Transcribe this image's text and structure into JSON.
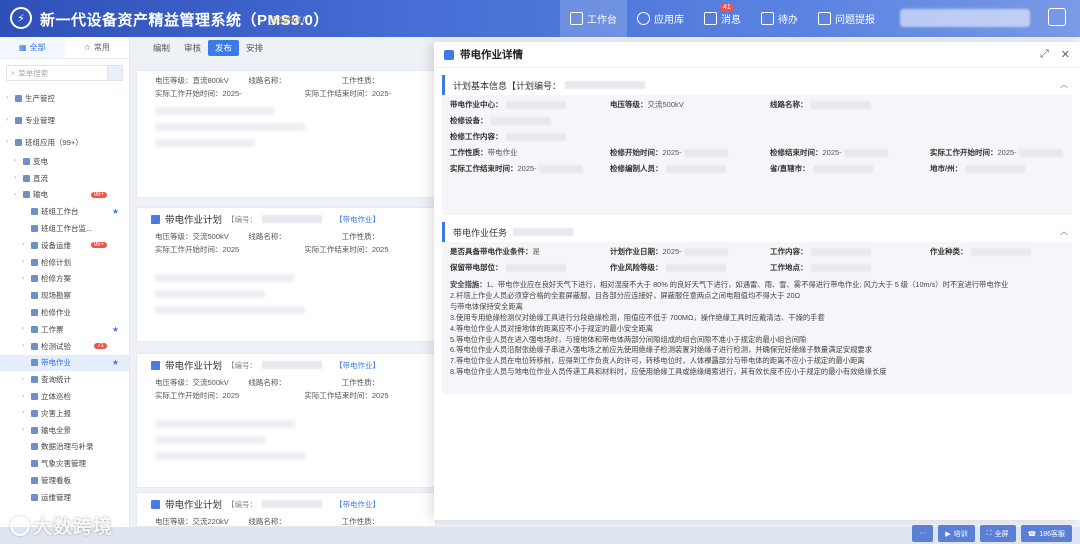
{
  "header": {
    "title": "新一代设备资产精益管理系统（PMS3.0）",
    "slogan": "我来修！",
    "nav": [
      {
        "label": "工作台",
        "icon": "monitor-icon"
      },
      {
        "label": "应用库",
        "icon": "apps-icon"
      },
      {
        "label": "消息",
        "icon": "message-icon",
        "badge": "41"
      },
      {
        "label": "待办",
        "icon": "todo-icon"
      },
      {
        "label": "问题提报",
        "icon": "report-icon"
      }
    ]
  },
  "sidebar": {
    "tabs": [
      "全部",
      "常用"
    ],
    "search_placeholder": "菜单搜索",
    "items": [
      {
        "label": "生产管控",
        "level": 1
      },
      {
        "label": "专业管理",
        "level": 1
      },
      {
        "label": "班组应用（99+）",
        "level": 1
      },
      {
        "label": "变电",
        "level": 2
      },
      {
        "label": "直流",
        "level": 2
      },
      {
        "label": "输电",
        "level": 2,
        "badge": "99+"
      },
      {
        "label": "班组工作台",
        "level": 3,
        "star": true
      },
      {
        "label": "班组工作台监...",
        "level": 3
      },
      {
        "label": "设备运维",
        "level": 3,
        "badge": "99+"
      },
      {
        "label": "检修计划",
        "level": 3
      },
      {
        "label": "检修方案",
        "level": 3
      },
      {
        "label": "现场勘察",
        "level": 3
      },
      {
        "label": "检修作业",
        "level": 3
      },
      {
        "label": "工作票",
        "level": 3,
        "star": true
      },
      {
        "label": "检测试验",
        "level": 3,
        "badge": "71"
      },
      {
        "label": "带电作业",
        "level": 3,
        "star": true,
        "active": true
      },
      {
        "label": "查询统计",
        "level": 3
      },
      {
        "label": "立体巡检",
        "level": 3
      },
      {
        "label": "灾害上报",
        "level": 3
      },
      {
        "label": "输电全景",
        "level": 3
      },
      {
        "label": "数据治理与补录",
        "level": 3
      },
      {
        "label": "气象灾害管理",
        "level": 3
      },
      {
        "label": "管理看板",
        "level": 3
      },
      {
        "label": "运维管理",
        "level": 3
      }
    ]
  },
  "main": {
    "subtabs": [
      "编制",
      "审核",
      "发布",
      "安排"
    ],
    "active_subtab": "发布",
    "top_fields": {
      "voltage": "电压等级：直流800kV",
      "line": "线路名称：",
      "nature": "工作性质：",
      "start": "实际工作开始时间：2025-",
      "end": "实际工作结束时间：2025-"
    },
    "cards": [
      {
        "title": "带电作业计划",
        "code": "【编号：",
        "tag": "【带电作业】",
        "voltage": "电压等级：交流500kV",
        "line": "线路名称：",
        "nature": "工作性质：",
        "start": "实际工作开始时间：2025",
        "end": "实际工作结束时间：2025"
      },
      {
        "title": "带电作业计划",
        "code": "【编号：",
        "tag": "【带电作业】",
        "voltage": "电压等级：交流500kV",
        "line": "线路名称：",
        "nature": "工作性质：",
        "start": "实际工作开始时间：2025",
        "end": "实际工作结束时间：2025"
      },
      {
        "title": "带电作业计划",
        "code": "【编号：",
        "tag": "【带电作业】",
        "voltage": "电压等级：交流220kV",
        "line": "线路名称：",
        "nature": "工作性质：",
        "start": "实际工作开始时间：2025",
        "end": "实际工作结束时间：2025"
      }
    ]
  },
  "drawer": {
    "title": "带电作业详情",
    "basic_section": "计划基本信息【计划编号：",
    "basic_rows": [
      [
        {
          "k": "带电作业中心：",
          "v": ""
        },
        {
          "k": "电压等级：",
          "v": "交流500kV"
        },
        {
          "k": "线路名称：",
          "v": ""
        },
        {
          "k": "",
          "v": ""
        }
      ],
      [
        {
          "k": "检修设备：",
          "v": ""
        },
        {
          "k": "",
          "v": ""
        },
        {
          "k": "",
          "v": ""
        },
        {
          "k": "",
          "v": ""
        }
      ],
      [
        {
          "k": "检修工作内容：",
          "v": ""
        },
        {
          "k": "",
          "v": ""
        },
        {
          "k": "",
          "v": ""
        },
        {
          "k": "",
          "v": ""
        }
      ],
      [
        {
          "k": "工作性质：",
          "v": "带电作业"
        },
        {
          "k": "检修开始时间：",
          "v": "2025-"
        },
        {
          "k": "检修结束时间：",
          "v": "2025-"
        },
        {
          "k": "实际工作开始时间：",
          "v": "2025-"
        }
      ],
      [
        {
          "k": "实际工作结束时间：",
          "v": "2025-"
        },
        {
          "k": "检修编制人员：",
          "v": ""
        },
        {
          "k": "省/直辖市：",
          "v": ""
        },
        {
          "k": "地市/州：",
          "v": ""
        }
      ]
    ],
    "task_section": "带电作业任务",
    "task_rows": [
      [
        {
          "k": "是否具备带电作业条件：",
          "v": "是"
        },
        {
          "k": "计划作业日期：",
          "v": "2025-"
        },
        {
          "k": "工作内容：",
          "v": ""
        },
        {
          "k": "作业种类：",
          "v": ""
        }
      ],
      [
        {
          "k": "保留带电部位：",
          "v": ""
        },
        {
          "k": "作业风险等级：",
          "v": ""
        },
        {
          "k": "工作地点：",
          "v": ""
        },
        {
          "k": "",
          "v": ""
        }
      ]
    ],
    "measures_label": "安全措施：",
    "measures": [
      "1、带电作业应在良好天气下进行，相对湿度不大于 80% 的良好天气下进行，如遇雷、雨、雪、雾不得进行带电作业; 风力大于 5 级（10m/s）时不宜进行带电作业",
      "2.杆塔上作业人员必须穿合格的全套屏蔽服，且各部分应连接好，屏蔽服任意两点之间电阻值均不得大于 20Ω",
      "与带电体保持安全距离",
      "3.使用专用绝缘检测仪对绝缘工具进行分段绝缘检测，阻值应不低于 700MΩ，操作绝缘工具时应戴清洁、干燥的手套",
      "4.等电位作业人员对接地体的距离应不小于规定的最小安全距离",
      "5.等电位作业人员在进入强电场时，与接地体和带电体两部分间隙组成的组合间隙不准小于规定的最小组合间隙",
      "6.等电位作业人员沿耐张绝缘子串进入强电场之前应先使用绝缘子检测装置对绝缘子进行检测，并确保完好绝缘子数量满足安规要求",
      "7.等电位作业人员在电位转移前，应得到工作负责人的许可，转移电位时，人体裸露部分与带电体的距离不应小于规定的最小距离",
      "8.等电位作业人员与地电位作业人员传递工具和材料时，应使用绝缘工具或绝缘绳索进行，其有效长度不应小于规定的最小有效绝缘长度"
    ]
  },
  "footer": {
    "watermark": "大数跨境",
    "buttons": [
      {
        "label": "···",
        "icon": "more-icon"
      },
      {
        "label": "培训",
        "icon": "video-icon"
      },
      {
        "label": "全屏",
        "icon": "fullscreen-icon"
      },
      {
        "label": "186客服",
        "icon": "service-icon"
      }
    ]
  }
}
